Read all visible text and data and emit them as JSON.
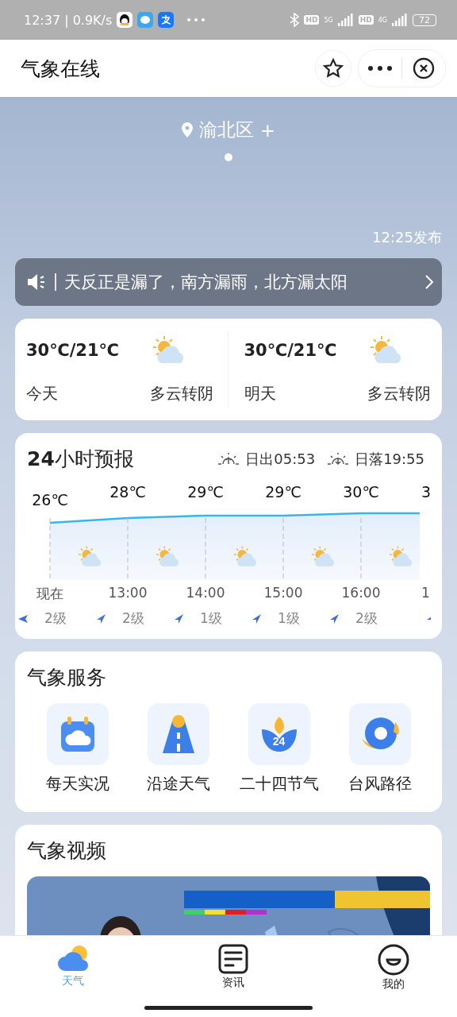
{
  "status_bar": {
    "time": "12:37 | 0.9K/s",
    "badges": [
      "HD",
      "5G",
      "HD",
      "4G"
    ],
    "battery": "72"
  },
  "header": {
    "title": "气象在线"
  },
  "location": {
    "name": "渝北区",
    "add": "+",
    "pages": [
      {
        "selected": true
      }
    ]
  },
  "published": "12:25发布",
  "notice": {
    "text": "天反正是漏了，南方漏雨，北方漏太阳"
  },
  "daily": [
    {
      "temp": "30℃/21℃",
      "day": "今天",
      "condition": "多云转阴"
    },
    {
      "temp": "30℃/21℃",
      "day": "明天",
      "condition": "多云转阴"
    }
  ],
  "hourly": {
    "title": "24小时预报",
    "sunrise": "日出05:53",
    "sunset": "日落19:55",
    "hours": [
      {
        "temp": "26℃",
        "time": "现在",
        "wind": "2级"
      },
      {
        "temp": "28℃",
        "time": "13:00",
        "wind": "2级"
      },
      {
        "temp": "29℃",
        "time": "14:00",
        "wind": "1级"
      },
      {
        "temp": "29℃",
        "time": "15:00",
        "wind": "1级"
      },
      {
        "temp": "30℃",
        "time": "16:00",
        "wind": "2级"
      },
      {
        "temp": "3",
        "time": "1"
      }
    ]
  },
  "services": {
    "title": "气象服务",
    "items": [
      {
        "label": "每天实况",
        "kind": "live"
      },
      {
        "label": "沿途天气",
        "kind": "road"
      },
      {
        "label": "二十四节气",
        "kind": "solar",
        "badge": "24"
      },
      {
        "label": "台风路径",
        "kind": "typhoon"
      }
    ]
  },
  "videos": {
    "title": "气象视频"
  },
  "tabs": [
    {
      "label": "天气",
      "kind": "weather",
      "selected": true
    },
    {
      "label": "资讯",
      "kind": "news",
      "selected": false
    },
    {
      "label": "我的",
      "kind": "me",
      "selected": false
    }
  ]
}
